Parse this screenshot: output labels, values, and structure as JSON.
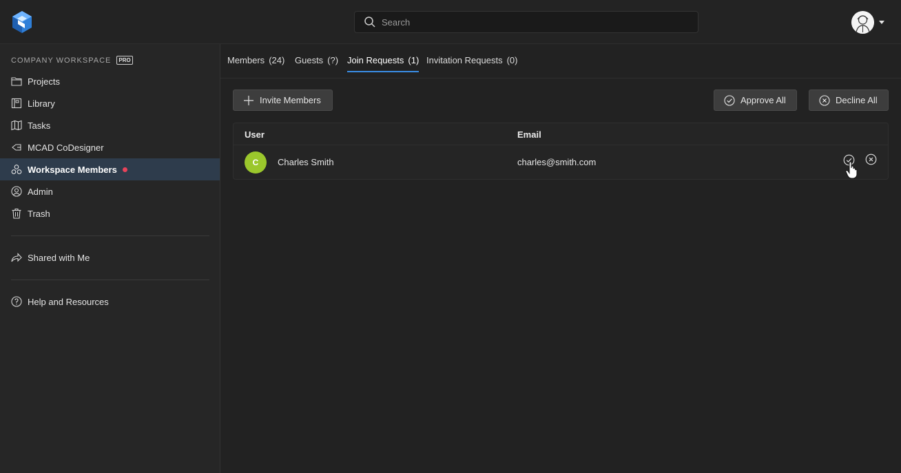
{
  "search": {
    "placeholder": "Search"
  },
  "sidebar": {
    "workspace_label": "COMPANY WORKSPACE",
    "badge": "PRO",
    "items": [
      {
        "label": "Projects",
        "icon": "folder-icon"
      },
      {
        "label": "Library",
        "icon": "library-icon"
      },
      {
        "label": "Tasks",
        "icon": "tasks-icon"
      },
      {
        "label": "MCAD CoDesigner",
        "icon": "codesigner-icon"
      },
      {
        "label": "Workspace Members",
        "icon": "members-icon",
        "active": true,
        "notification": true
      },
      {
        "label": "Admin",
        "icon": "admin-icon"
      },
      {
        "label": "Trash",
        "icon": "trash-icon"
      }
    ],
    "shared": {
      "label": "Shared with Me",
      "icon": "share-icon"
    },
    "help": {
      "label": "Help and Resources",
      "icon": "help-icon"
    }
  },
  "tabs": [
    {
      "label": "Members",
      "count": "(24)"
    },
    {
      "label": "Guests",
      "count": "(?)"
    },
    {
      "label": "Join Requests",
      "count": "(1)",
      "active": true
    },
    {
      "label": "Invitation Requests",
      "count": "(0)"
    }
  ],
  "actions": {
    "invite": "Invite Members",
    "approve_all": "Approve All",
    "decline_all": "Decline All"
  },
  "table": {
    "columns": [
      "User",
      "Email"
    ],
    "rows": [
      {
        "initial": "C",
        "name": "Charles Smith",
        "email": "charles@smith.com",
        "avatar_color": "#9bc72c"
      }
    ]
  },
  "colors": {
    "accent": "#3a8ee6",
    "active_nav_bg": "#2e3c4c",
    "notification": "#e8435a"
  }
}
